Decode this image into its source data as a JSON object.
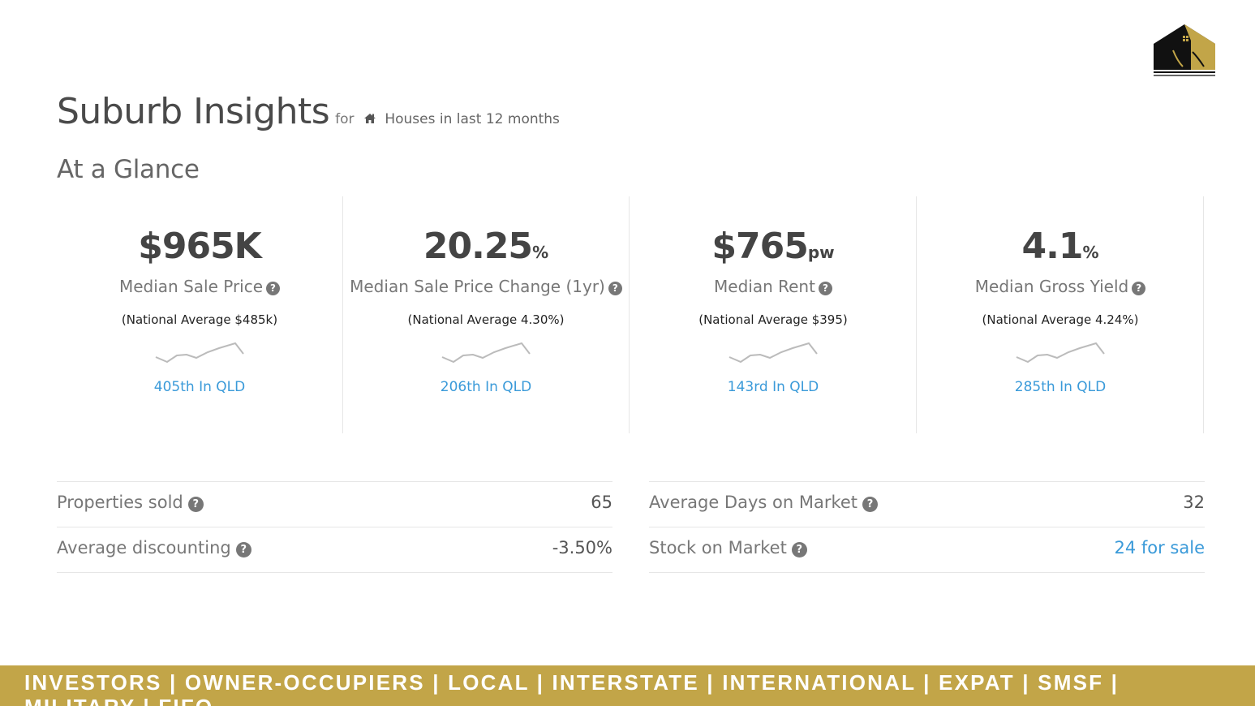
{
  "header": {
    "title": "Suburb Insights",
    "subtitle_for": "for",
    "subtitle_text": "Houses in last 12 months",
    "home_icon": "home-icon",
    "logo_icon": "you-and-me-logo"
  },
  "at_a_glance": {
    "title": "At a Glance",
    "stats": [
      {
        "value": "$965K",
        "unit": "",
        "label": "Median Sale Price",
        "note": "(National Average $485k)",
        "rank": "405th In QLD"
      },
      {
        "value": "20.25",
        "unit": "%",
        "label": "Median Sale Price Change (1yr)",
        "note": "(National Average 4.30%)",
        "rank": "206th In QLD"
      },
      {
        "value": "$765",
        "unit": "pw",
        "label": "Median Rent",
        "note": "(National Average $395)",
        "rank": "143rd In QLD"
      },
      {
        "value": "4.1",
        "unit": "%",
        "label": "Median Gross Yield",
        "note": "(National Average 4.24%)",
        "rank": "285th In QLD"
      }
    ]
  },
  "metrics_left": [
    {
      "label": "Properties sold",
      "value": "65"
    },
    {
      "label": "Average discounting",
      "value": "-3.50%"
    }
  ],
  "metrics_right": [
    {
      "label": "Average Days on Market",
      "value": "32"
    },
    {
      "label": "Stock on Market",
      "value": "24 for sale"
    }
  ],
  "footer": {
    "text": "INVESTORS | OWNER-OCCUPIERS | LOCAL | INTERSTATE | INTERNATIONAL | EXPAT | SMSF | MILITARY | FIFO"
  },
  "colors": {
    "accent_gold": "#c2a548",
    "link_blue": "#3a9ad9",
    "text_dark": "#444444"
  }
}
